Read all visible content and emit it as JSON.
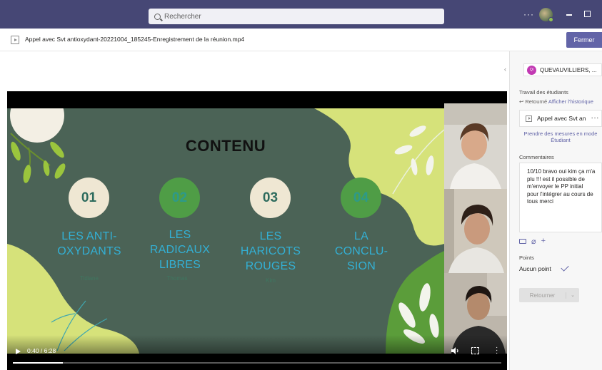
{
  "topbar": {
    "search_placeholder": "Rechercher",
    "more_label": "···",
    "avatar_icon": "user-avatar",
    "accent": "#464775"
  },
  "file": {
    "title": "Appel avec Svt antioxydant-20221004_185245-Enregistrement de la réunion.mp4",
    "close_label": "Fermer",
    "icon": "video-file-icon"
  },
  "slide": {
    "title": "CONTENU",
    "items": [
      {
        "number": "01",
        "label_lines": [
          "LES ANTI-",
          "OXYDANTS"
        ],
        "presenter": "Tidiane"
      },
      {
        "number": "02",
        "label_lines": [
          "LES",
          "RADICAUX",
          "LIBRES"
        ],
        "presenter": "Thomas"
      },
      {
        "number": "03",
        "label_lines": [
          "LES",
          "HARICOTS",
          "ROUGES"
        ],
        "presenter": "Kim"
      },
      {
        "number": "04",
        "label_lines": [
          "LA",
          "CONCLU-",
          "SION"
        ],
        "presenter": ""
      }
    ]
  },
  "player": {
    "time": "0:40 / 6:28",
    "progress_fraction": 0.103,
    "icons": [
      "play-icon",
      "volume-icon",
      "fullscreen-icon",
      "more-vertical-icon"
    ]
  },
  "panel": {
    "student_initials": "Qi",
    "student_name": "QUEVAUVILLIERS, ...",
    "work_heading": "Travail des étudiants",
    "returned_label": "Retourné",
    "history_link": "Afficher l'historique",
    "attachment_name": "Appel avec Svt an",
    "attachment_more": "···",
    "measure_link": "Prendre des mesures en mode Étudiant",
    "comments_heading": "Commentaires",
    "comment_text": "10/10 bravo oui kim ça m'a plu !!! est il possible de m'envoyer le PP initial pour l'intégrer au cours de tous merci",
    "points_heading": "Points",
    "points_value": "Aucun point",
    "return_button": "Retourner"
  }
}
